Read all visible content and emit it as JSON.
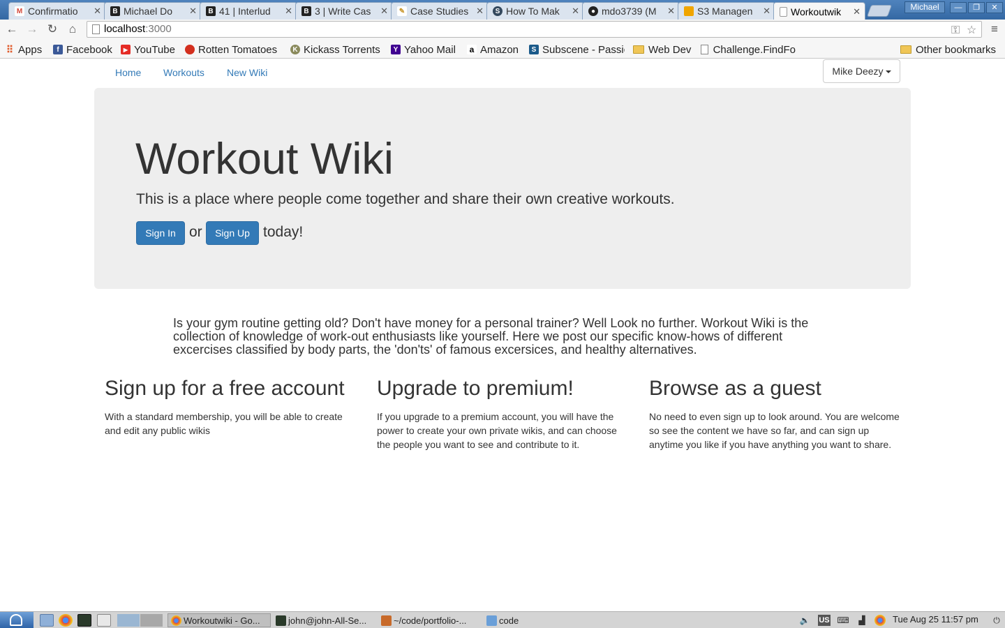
{
  "browser": {
    "tabs": [
      {
        "title": "Confirmatio",
        "favicon": "gmail-icon",
        "color": "#d44638",
        "glyph": "M"
      },
      {
        "title": "Michael Do",
        "favicon": "bloc-icon",
        "color": "#222222",
        "glyph": "B"
      },
      {
        "title": "41 | Interlud",
        "favicon": "bloc-icon",
        "color": "#222222",
        "glyph": "B"
      },
      {
        "title": "3 | Write Cas",
        "favicon": "bloc-icon",
        "color": "#222222",
        "glyph": "B"
      },
      {
        "title": "Case Studies",
        "favicon": "pencil-icon",
        "color": "#e0b040",
        "glyph": "✎"
      },
      {
        "title": "How To Mak",
        "favicon": "s-icon",
        "color": "#34495e",
        "glyph": "S"
      },
      {
        "title": "mdo3739 (M",
        "favicon": "github-icon",
        "color": "#222222",
        "glyph": "●"
      },
      {
        "title": "S3 Managen",
        "favicon": "aws-icon",
        "color": "#f0a500",
        "glyph": "▣"
      },
      {
        "title": "Workoutwik",
        "favicon": "page-icon",
        "color": "#ffffff",
        "glyph": ""
      }
    ],
    "profile_name": "Michael",
    "address": {
      "host": "localhost",
      "port": ":3000"
    },
    "bookmarks": [
      {
        "label": "Apps",
        "icon": "apps-icon",
        "color": "#e05a2b",
        "glyph": "⠿"
      },
      {
        "label": "Facebook",
        "icon": "facebook-icon",
        "color": "#3b5998",
        "glyph": "f"
      },
      {
        "label": "YouTube",
        "icon": "youtube-icon",
        "color": "#e52d27",
        "glyph": "▶"
      },
      {
        "label": "Rotten Tomatoes",
        "icon": "tomato-icon",
        "color": "#d32f1e",
        "glyph": "●"
      },
      {
        "label": "Kickass Torrents",
        "icon": "kat-icon",
        "color": "#8a8a5c",
        "glyph": "K"
      },
      {
        "label": "Yahoo Mail",
        "icon": "yahoo-icon",
        "color": "#400191",
        "glyph": "Y"
      },
      {
        "label": "Amazon",
        "icon": "amazon-icon",
        "color": "#ffffff",
        "glyph": "a"
      },
      {
        "label": "Subscene - Passic",
        "icon": "subscene-icon",
        "color": "#1b5a8a",
        "glyph": "S"
      },
      {
        "label": "Web Dev",
        "icon": "folder-icon"
      },
      {
        "label": "Challenge.FindFo",
        "icon": "page-icon"
      }
    ],
    "other_bookmarks": "Other bookmarks"
  },
  "site": {
    "nav": [
      "Home",
      "Workouts",
      "New Wiki"
    ],
    "user_menu": "Mike Deezy",
    "jumbotron": {
      "title": "Workout Wiki",
      "lead": "This is a place where people come together and share their own creative workouts.",
      "sign_in": "Sign In",
      "or": "or",
      "sign_up": "Sign Up",
      "today": "today!"
    },
    "intro": "Is your gym routine getting old? Don't have money for a personal trainer? Well Look no further. Workout Wiki is the collection of knowledge of work-out enthusiasts like yourself. Here we post our specific know-hows of different excercises classified by body parts, the 'don'ts' of famous excersices, and healthy alternatives.",
    "columns": [
      {
        "heading": "Sign up for a free account",
        "text": "With a standard membership, you will be able to create and edit any public wikis"
      },
      {
        "heading": "Upgrade to premium!",
        "text": "If you upgrade to a premium account, you will have the power to create your own private wikis, and can choose the people you want to see and contribute to it."
      },
      {
        "heading": "Browse as a guest",
        "text": "No need to even sign up to look around. You are welcome so see the content we have so far, and can sign up anytime you like if you have anything you want to share."
      }
    ]
  },
  "taskbar": {
    "tasks": [
      {
        "label": "Workoutwiki - Go...",
        "icon": "chrome-icon"
      },
      {
        "label": "john@john-All-Se...",
        "icon": "terminal-icon"
      },
      {
        "label": "~/code/portfolio-...",
        "icon": "editor-icon"
      },
      {
        "label": "code",
        "icon": "folder-icon"
      }
    ],
    "keyboard_layout": "US",
    "clock": "Tue Aug 25  11:57 pm"
  },
  "colors": {
    "link": "#337ab7",
    "primary_button": "#337ab7",
    "jumbotron_bg": "#eeeeee"
  }
}
